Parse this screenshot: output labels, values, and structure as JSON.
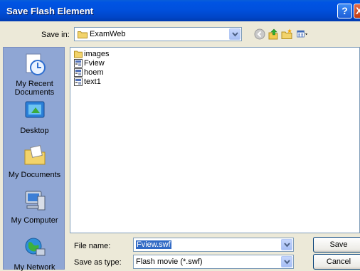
{
  "window": {
    "title": "Save Flash Element"
  },
  "titlebar": {
    "help": "?",
    "close": "X"
  },
  "save_in": {
    "label": "Save in:",
    "value": "ExamWeb"
  },
  "places": [
    {
      "name": "recent",
      "label": "My Recent Documents"
    },
    {
      "name": "desktop",
      "label": "Desktop"
    },
    {
      "name": "documents",
      "label": "My Documents"
    },
    {
      "name": "computer",
      "label": "My Computer"
    },
    {
      "name": "network",
      "label": "My Network"
    }
  ],
  "files": [
    {
      "name": "images",
      "type": "folder"
    },
    {
      "name": "Fview",
      "type": "swf"
    },
    {
      "name": "hoem",
      "type": "swf"
    },
    {
      "name": "text1",
      "type": "swf"
    }
  ],
  "file_name": {
    "label": "File name:",
    "value": "Fview.swf"
  },
  "save_as_type": {
    "label": "Save as type:",
    "value": "Flash movie (*.swf)"
  },
  "buttons": {
    "save": "Save",
    "cancel": "Cancel"
  },
  "colors": {
    "titlebar": "#0054E3",
    "places_bar": "#8FA6D4",
    "dialog_bg": "#ECE9D8",
    "selection": "#316AC5"
  }
}
